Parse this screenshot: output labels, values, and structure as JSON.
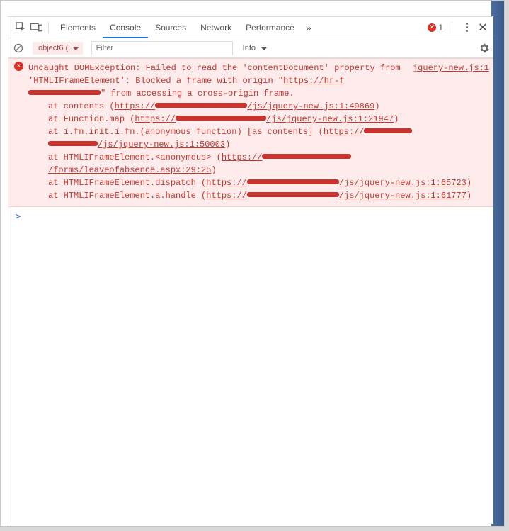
{
  "tabs": {
    "elements": "Elements",
    "console": "Console",
    "sources": "Sources",
    "network": "Network",
    "performance": "Performance"
  },
  "errorCount": "1",
  "context": "object6 (l",
  "filterPlaceholder": "Filter",
  "level": "Info",
  "error": {
    "source": "jquery-new.js:1",
    "head": "Uncaught DOMException: Failed to read the 'contentDocument' property from 'HTMLIFrameElement': Blocked a frame with origin \"",
    "headLink": "https://hr-f",
    "headTail": "\" from accessing a cross-origin frame.",
    "s1a": "at contents (",
    "s1l": "https://",
    "s1l2": "/js/jquery-new.js:1:49869",
    "s1c": ")",
    "s2a": "at Function.map (",
    "s2l": "https://",
    "s2l2": "/js/jquery-new.js:1:21947",
    "s2c": ")",
    "s3a": "at i.fn.init.i.fn.(anonymous function) [as contents] (",
    "s3l": "https://",
    "s3l2": "/js/jquery-new.js:1:50003",
    "s3c": ")",
    "s4a": "at HTMLIFrameElement.<anonymous> (",
    "s4l": "https://",
    "s4l2": "/forms/leaveofabsence.aspx:29:25",
    "s4c": ")",
    "s5a": "at HTMLIFrameElement.dispatch (",
    "s5l": "https://",
    "s5l2": "/js/jquery-new.js:1:65723",
    "s5c": ")",
    "s6a": "at HTMLIFrameElement.a.handle (",
    "s6l": "https://",
    "s6l2": "/js/jquery-new.js:1:61777",
    "s6c": ")"
  },
  "prompt": ">"
}
